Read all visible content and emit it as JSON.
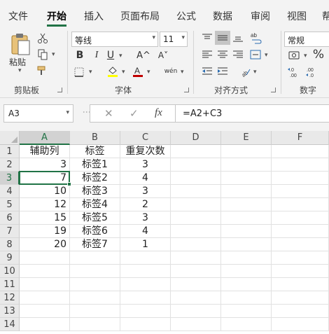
{
  "menu": {
    "tabs": [
      "文件",
      "开始",
      "插入",
      "页面布局",
      "公式",
      "数据",
      "审阅",
      "视图",
      "帮"
    ],
    "active_tab": "开始"
  },
  "ribbon": {
    "clipboard": {
      "paste_label": "粘贴",
      "group_label": "剪贴板"
    },
    "font": {
      "font_name": "等线",
      "font_size": "11",
      "group_label": "字体",
      "bold": "B",
      "italic": "I",
      "underline": "U",
      "grow": "A^",
      "shrink": "A˅",
      "phonetic": "wén"
    },
    "alignment": {
      "group_label": "对齐方式"
    },
    "number": {
      "format": "常规",
      "percent": "%",
      "group_label": "数字"
    }
  },
  "formula_bar": {
    "name_box": "A3",
    "cancel": "✕",
    "enter": "✓",
    "fx": "fx",
    "formula": "=A2+C3"
  },
  "grid": {
    "columns": [
      "A",
      "B",
      "C",
      "D",
      "E",
      "F"
    ],
    "selected_column": "A",
    "row_numbers": [
      "1",
      "2",
      "3",
      "4",
      "5",
      "6",
      "7",
      "8",
      "9",
      "10",
      "11",
      "12",
      "13",
      "14"
    ],
    "selected_row": "3",
    "header": {
      "a": "辅助列",
      "b": "标签",
      "c": "重复次数"
    },
    "rows": [
      {
        "a": "3",
        "b": "标签1",
        "c": "3"
      },
      {
        "a": "7",
        "b": "标签2",
        "c": "4"
      },
      {
        "a": "10",
        "b": "标签3",
        "c": "3"
      },
      {
        "a": "12",
        "b": "标签4",
        "c": "2"
      },
      {
        "a": "15",
        "b": "标签5",
        "c": "3"
      },
      {
        "a": "19",
        "b": "标签6",
        "c": "4"
      },
      {
        "a": "20",
        "b": "标签7",
        "c": "1"
      }
    ]
  },
  "colors": {
    "accent": "#217346",
    "font_color_bar": "#c00000",
    "fill_color_bar": "#ffff00"
  }
}
